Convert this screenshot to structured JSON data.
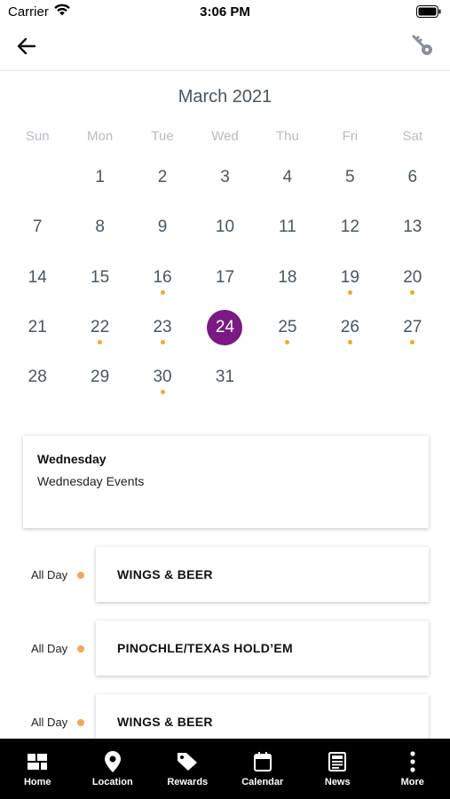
{
  "status_bar": {
    "carrier": "Carrier",
    "time": "3:06 PM"
  },
  "nav": {
    "back_icon": "arrow-left-icon",
    "key_icon": "key-icon"
  },
  "calendar": {
    "month_title": "March 2021",
    "weekdays": [
      "Sun",
      "Mon",
      "Tue",
      "Wed",
      "Thu",
      "Fri",
      "Sat"
    ],
    "leading_blanks": 1,
    "days": [
      "1",
      "2",
      "3",
      "4",
      "5",
      "6",
      "7",
      "8",
      "9",
      "10",
      "11",
      "12",
      "13",
      "14",
      "15",
      "16",
      "17",
      "18",
      "19",
      "20",
      "21",
      "22",
      "23",
      "24",
      "25",
      "26",
      "27",
      "28",
      "29",
      "30",
      "31"
    ],
    "event_days": [
      "16",
      "19",
      "20",
      "22",
      "23",
      "25",
      "26",
      "27",
      "30"
    ],
    "selected_day": "24",
    "accent_color": "#7a1a82",
    "dot_color": "#f0a830"
  },
  "day_card": {
    "title": "Wednesday",
    "subtitle": "Wednesday Events"
  },
  "events": [
    {
      "time": "All Day",
      "title": "WINGS & BEER"
    },
    {
      "time": "All Day",
      "title": "PINOCHLE/TEXAS HOLD’EM"
    },
    {
      "time": "All Day",
      "title": "WINGS & BEER"
    }
  ],
  "tabs": [
    {
      "label": "Home",
      "icon": "home-grid-icon"
    },
    {
      "label": "Location",
      "icon": "location-pin-icon"
    },
    {
      "label": "Rewards",
      "icon": "tag-icon"
    },
    {
      "label": "Calendar",
      "icon": "calendar-icon"
    },
    {
      "label": "News",
      "icon": "newspaper-icon"
    },
    {
      "label": "More",
      "icon": "more-vertical-icon"
    }
  ]
}
